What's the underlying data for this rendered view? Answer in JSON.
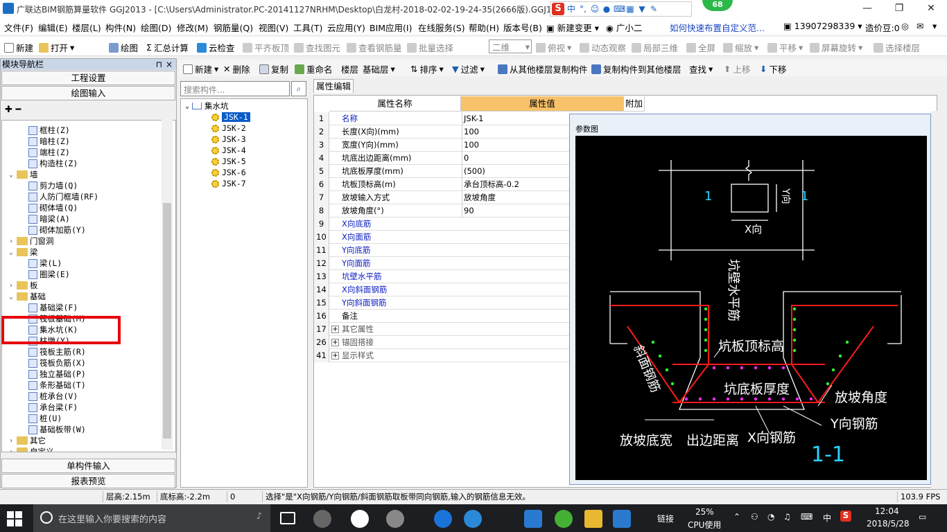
{
  "window": {
    "title": "广联达BIM钢筋算量软件 GGJ2013 - [C:\\Users\\Administrator.PC-20141127NRHM\\Desktop\\白龙村-2018-02-02-19-24-35(2666版).GGJ12]",
    "minimize": "—",
    "restore": "❐",
    "close": "✕",
    "badge": "68",
    "ime_label": "中"
  },
  "menubar": {
    "items": [
      "文件(F)",
      "编辑(E)",
      "楼层(L)",
      "构件(N)",
      "绘图(D)",
      "修改(M)",
      "钢筋量(Q)",
      "视图(V)",
      "工具(T)",
      "云应用(Y)",
      "BIM应用(I)",
      "在线服务(S)",
      "帮助(H)",
      "版本号(B)"
    ],
    "new_change": "新建变更",
    "assistant": "广小二",
    "hint_link": "如何快速布置自定义范...",
    "phone": "13907298339",
    "price_coin": "造价豆:0"
  },
  "toolbar1": {
    "new": "新建",
    "open": "打开",
    "draw": "绘图",
    "sum_calc": "汇总计算",
    "cloud_check": "云检查",
    "flush_board_top": "平齐板顶",
    "find_element": "查找图元",
    "view_rebar": "查看钢筋量",
    "batch_select": "批量选择",
    "view_mode": "二维",
    "top_view": "俯视",
    "dynamic_view": "动态观察",
    "local_3d": "局部三维",
    "full_screen": "全屏",
    "zoom": "缩放",
    "pan": "平移",
    "screen_rotate": "屏幕旋转",
    "select_floor": "选择楼层"
  },
  "left_panel": {
    "header": "模块导航栏",
    "pin": "⊓",
    "close": "×",
    "project_settings": "工程设置",
    "drawing_input": "绘图输入",
    "single_input": "单构件输入",
    "report_preview": "报表预览",
    "tree": [
      {
        "label": "框柱(Z)",
        "kind": "item"
      },
      {
        "label": "暗柱(Z)",
        "kind": "item"
      },
      {
        "label": "端柱(Z)",
        "kind": "item"
      },
      {
        "label": "构造柱(Z)",
        "kind": "item"
      },
      {
        "label": "墙",
        "kind": "folder-open"
      },
      {
        "label": "剪力墙(Q)",
        "kind": "item"
      },
      {
        "label": "人防门框墙(RF)",
        "kind": "item"
      },
      {
        "label": "砌体墙(Q)",
        "kind": "item"
      },
      {
        "label": "暗梁(A)",
        "kind": "item"
      },
      {
        "label": "砌体加筋(Y)",
        "kind": "item"
      },
      {
        "label": "门窗洞",
        "kind": "folder"
      },
      {
        "label": "梁",
        "kind": "folder-open"
      },
      {
        "label": "梁(L)",
        "kind": "item"
      },
      {
        "label": "圈梁(E)",
        "kind": "item"
      },
      {
        "label": "板",
        "kind": "folder"
      },
      {
        "label": "基础",
        "kind": "folder-open"
      },
      {
        "label": "基础梁(F)",
        "kind": "item"
      },
      {
        "label": "筏板基础(M)",
        "kind": "item"
      },
      {
        "label": "集水坑(K)",
        "kind": "item"
      },
      {
        "label": "柱墩(Y)",
        "kind": "item"
      },
      {
        "label": "筏板主筋(R)",
        "kind": "item"
      },
      {
        "label": "筏板负筋(X)",
        "kind": "item"
      },
      {
        "label": "独立基础(P)",
        "kind": "item"
      },
      {
        "label": "条形基础(T)",
        "kind": "item"
      },
      {
        "label": "桩承台(V)",
        "kind": "item"
      },
      {
        "label": "承台梁(F)",
        "kind": "item"
      },
      {
        "label": "桩(U)",
        "kind": "item"
      },
      {
        "label": "基础板带(W)",
        "kind": "item"
      },
      {
        "label": "其它",
        "kind": "folder"
      },
      {
        "label": "自定义",
        "kind": "folder"
      }
    ]
  },
  "mid_toolbar": {
    "new": "新建",
    "delete": "删除",
    "copy": "复制",
    "rename": "重命名",
    "floor_label": "楼层",
    "floor_value": "基础层",
    "sort": "排序",
    "filter": "过滤",
    "copy_from_floor": "从其他楼层复制构件",
    "copy_to_floor": "复制构件到其他楼层",
    "find": "查找",
    "move_up": "上移",
    "move_down": "下移"
  },
  "component_tree": {
    "search_placeholder": "搜索构件...",
    "root": "集水坑",
    "items": [
      "JSK-1",
      "JSK-2",
      "JSK-3",
      "JSK-4",
      "JSK-5",
      "JSK-6",
      "JSK-7"
    ],
    "selected": "JSK-1"
  },
  "property_grid": {
    "tab": "属性编辑",
    "col_name": "属性名称",
    "col_value": "属性值",
    "col_extra": "附加",
    "rows": [
      {
        "n": "1",
        "name": "名称",
        "value": "JSK-1",
        "blue": true
      },
      {
        "n": "2",
        "name": "长度(X向)(mm)",
        "value": "100",
        "blue": false
      },
      {
        "n": "3",
        "name": "宽度(Y向)(mm)",
        "value": "100",
        "blue": false
      },
      {
        "n": "4",
        "name": "坑底出边距离(mm)",
        "value": "0",
        "blue": false
      },
      {
        "n": "5",
        "name": "坑底板厚度(mm)",
        "value": "(500)",
        "blue": false
      },
      {
        "n": "6",
        "name": "坑板顶标高(m)",
        "value": "承台顶标高-0.2",
        "blue": false
      },
      {
        "n": "7",
        "name": "放坡输入方式",
        "value": "放坡角度",
        "blue": false
      },
      {
        "n": "8",
        "name": "放坡角度(°)",
        "value": "90",
        "blue": false
      },
      {
        "n": "9",
        "name": "X向底筋",
        "value": "",
        "blue": true
      },
      {
        "n": "10",
        "name": "X向面筋",
        "value": "",
        "blue": true
      },
      {
        "n": "11",
        "name": "Y向底筋",
        "value": "",
        "blue": true
      },
      {
        "n": "12",
        "name": "Y向面筋",
        "value": "",
        "blue": true
      },
      {
        "n": "13",
        "name": "坑壁水平筋",
        "value": "",
        "blue": true
      },
      {
        "n": "14",
        "name": "X向斜面钢筋",
        "value": "",
        "blue": true
      },
      {
        "n": "15",
        "name": "Y向斜面钢筋",
        "value": "",
        "blue": true
      },
      {
        "n": "16",
        "name": "备注",
        "value": "",
        "blue": false
      },
      {
        "n": "17",
        "name": "其它属性",
        "value": "",
        "blue": false,
        "group": true
      },
      {
        "n": "26",
        "name": "锚固搭接",
        "value": "",
        "blue": false,
        "group": true
      },
      {
        "n": "41",
        "name": "显示样式",
        "value": "",
        "blue": false,
        "group": true
      }
    ]
  },
  "param_diagram": {
    "title": "参数图",
    "labels": {
      "x_dir": "X向",
      "y_dir": "Y向",
      "section_mark": "1",
      "wall_horizontal_rebar": "坑壁水平筋",
      "slab_top_elev": "坑板顶标高",
      "bottom_slab_thickness": "坑底板厚度",
      "slope_rebar": "斜面钢筋",
      "slope_angle": "放坡角度",
      "y_rebar": "Y向钢筋",
      "x_rebar": "X向钢筋",
      "slope_bottom_width": "放坡底宽",
      "edge_distance": "出边距离",
      "section_name": "1-1"
    }
  },
  "statusbar": {
    "floor_height": "层高:2.15m",
    "bottom_elev": "底标高:-2.2m",
    "zero": "0",
    "hint": "选择\"是\"X向钢筋/Y向钢筋/斜面钢筋取板带同向钢筋,输入的钢筋信息无效。",
    "fps": "103.9 FPS"
  },
  "taskbar": {
    "search_placeholder": "在这里输入你要搜索的内容",
    "link": "链接",
    "cpu_percent": "25%",
    "cpu_label": "CPU使用",
    "ime": "中",
    "time": "12:04",
    "date": "2018/5/28"
  },
  "colors": {
    "accent": "#0a5cc8",
    "highlight_red": "#e8000c",
    "value_header": "#f7c26a"
  }
}
